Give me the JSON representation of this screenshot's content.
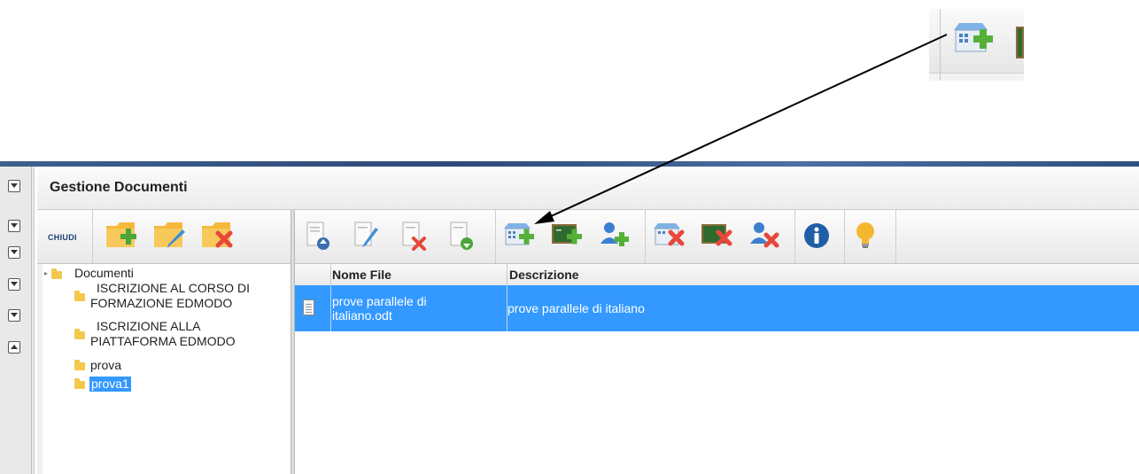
{
  "window": {
    "title": "Gestione Documenti"
  },
  "left_toolbar": {
    "close_label": "CHIUDI",
    "buttons": [
      {
        "icon": "folder-add-icon"
      },
      {
        "icon": "folder-edit-icon"
      },
      {
        "icon": "folder-delete-icon"
      }
    ]
  },
  "right_toolbar": {
    "buttons": [
      {
        "icon": "file-upload-icon"
      },
      {
        "icon": "file-edit-icon"
      },
      {
        "icon": "file-delete-icon"
      },
      {
        "icon": "file-add-icon"
      },
      {
        "icon": "school-add-icon"
      },
      {
        "icon": "class-add-icon"
      },
      {
        "icon": "user-add-icon"
      },
      {
        "icon": "school-remove-icon"
      },
      {
        "icon": "class-remove-icon"
      },
      {
        "icon": "user-remove-icon"
      },
      {
        "icon": "info-icon"
      },
      {
        "icon": "lightbulb-icon"
      }
    ]
  },
  "tree": {
    "root": "Documenti",
    "items": [
      {
        "line1": "ISCRIZIONE AL CORSO DI",
        "line2": "FORMAZIONE EDMODO"
      },
      {
        "line1": "ISCRIZIONE ALLA",
        "line2": "PIATTAFORMA EDMODO"
      },
      {
        "line1": "prova"
      },
      {
        "line1": "prova1",
        "selected": true
      }
    ]
  },
  "grid": {
    "columns": [
      "Nome File",
      "Descrizione"
    ],
    "rows": [
      {
        "file_line1": "prove parallele di",
        "file_line2": "italiano.odt",
        "description": "prove parallele di italiano"
      }
    ]
  },
  "colors": {
    "selection": "#3399ff",
    "header_strip": "#2c4a78",
    "folder": "#f2c94c"
  }
}
